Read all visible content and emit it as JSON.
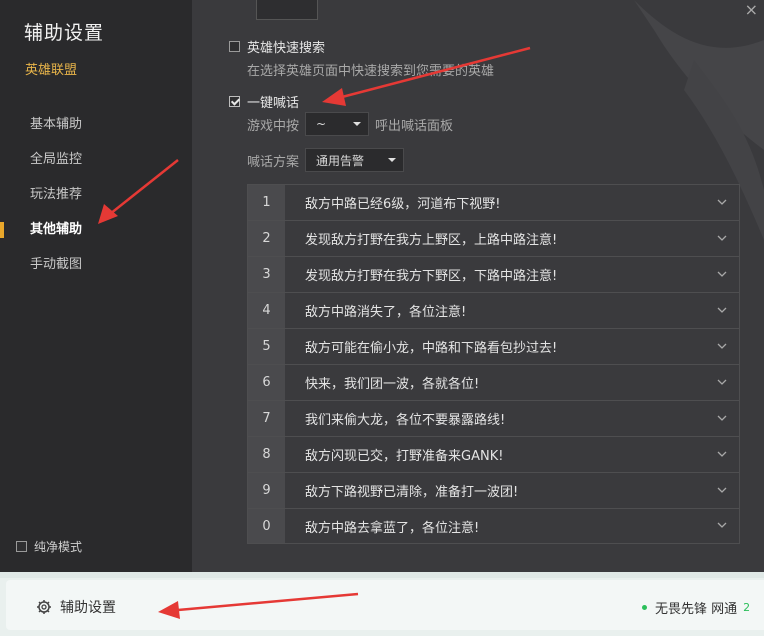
{
  "sidebar": {
    "title": "辅助设置",
    "game": "英雄联盟",
    "items": [
      {
        "label": "基本辅助"
      },
      {
        "label": "全局监控"
      },
      {
        "label": "玩法推荐"
      },
      {
        "label": "其他辅助"
      },
      {
        "label": "手动截图"
      }
    ],
    "pure_mode": "纯净模式"
  },
  "content": {
    "close": "×",
    "quick_search": {
      "label": "英雄快速搜索",
      "desc": "在选择英雄页面中快速搜索到您需要的英雄"
    },
    "one_key_shout": {
      "label": "一键喊话",
      "key_prefix": "游戏中按",
      "key_value": "~",
      "key_suffix": "呼出喊话面板",
      "scheme_label": "喊话方案",
      "scheme_value": "通用告警"
    },
    "phrases": [
      {
        "num": "1",
        "text": "敌方中路已经6级，河道布下视野!"
      },
      {
        "num": "2",
        "text": "发现敌方打野在我方上野区，上路中路注意!"
      },
      {
        "num": "3",
        "text": "发现敌方打野在我方下野区，下路中路注意!"
      },
      {
        "num": "4",
        "text": "敌方中路消失了，各位注意!"
      },
      {
        "num": "5",
        "text": "敌方可能在偷小龙，中路和下路看包抄过去!"
      },
      {
        "num": "6",
        "text": "快来，我们团一波，各就各位!"
      },
      {
        "num": "7",
        "text": "我们来偷大龙，各位不要暴露路线!"
      },
      {
        "num": "8",
        "text": "敌方闪现已交，打野准备来GANK!"
      },
      {
        "num": "9",
        "text": "敌方下路视野已清除，准备打一波团!"
      },
      {
        "num": "0",
        "text": "敌方中路去拿蓝了，各位注意!"
      }
    ]
  },
  "bottom": {
    "settings_label": "辅助设置",
    "status_name": "无畏先锋 网通",
    "status_badge": "2"
  },
  "colors": {
    "accent": "#e9a72b",
    "game_label": "#e9b54a",
    "annotation_arrow": "#e53935",
    "status_dot": "#2bbf5a"
  }
}
